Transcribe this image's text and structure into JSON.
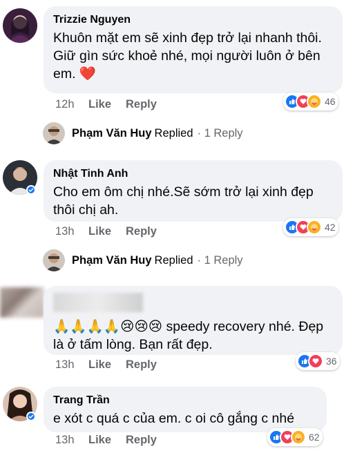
{
  "comments": [
    {
      "author": "Trizzie Nguyen",
      "text": "Khuôn mặt em sẽ xinh đẹp trở lại nhanh thôi.  Giữ gìn sức khoẻ nhé, mọi người luôn ở bên em. ❤️",
      "time": "12h",
      "like_label": "Like",
      "reply_label": "Reply",
      "reaction_count": "46",
      "reactions": [
        "like-icon",
        "love-icon",
        "care-icon"
      ],
      "reply": {
        "name": "Phạm Văn Huy",
        "replied": "Replied",
        "count": "· 1 Reply"
      }
    },
    {
      "author": "Nhật Tinh Anh",
      "text": "Cho em ôm chị nhé.Sẽ sớm trở lại xinh đẹp thôi chị ah.",
      "time": "13h",
      "like_label": "Like",
      "reply_label": "Reply",
      "reaction_count": "42",
      "reactions": [
        "like-icon",
        "love-icon",
        "care-icon"
      ],
      "reply": {
        "name": "Phạm Văn Huy",
        "replied": "Replied",
        "count": "· 1 Reply"
      }
    },
    {
      "author": "",
      "text": "🙏🙏🙏🙏😢😢😢 speedy recovery nhé. Đẹp là ở tấm lòng. Bạn rất đẹp.",
      "time": "13h",
      "like_label": "Like",
      "reply_label": "Reply",
      "reaction_count": "36",
      "reactions": [
        "like-icon",
        "love-icon"
      ]
    },
    {
      "author": "Trang Trần",
      "text": "e xót c quá c của em. c oi cô gắng c nhé",
      "time": "13h",
      "like_label": "Like",
      "reply_label": "Reply",
      "reaction_count": "62",
      "reactions": [
        "like-icon",
        "love-icon",
        "care-icon"
      ]
    }
  ],
  "colors": {
    "like": "#1877f2",
    "love": "#f33e58",
    "care": "#f7b125",
    "bubble": "#f0f2f5",
    "meta": "#65676b"
  }
}
